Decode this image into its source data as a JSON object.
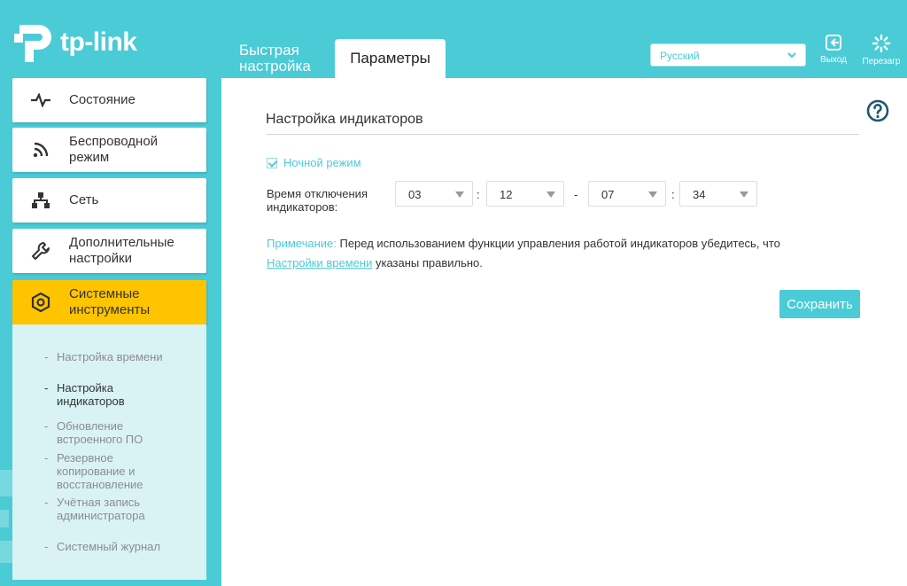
{
  "header": {
    "logo_text": "tp-link",
    "tabs": [
      {
        "label_line1": "Быстрая",
        "label_line2": "настройка"
      },
      {
        "label": "Параметры"
      }
    ],
    "language": {
      "selected": "Русский"
    },
    "logout_label": "Выход",
    "reboot_label": "Перезагр"
  },
  "sidebar": {
    "items": [
      {
        "label": "Состояние",
        "icon": "pulse-icon"
      },
      {
        "label_line1": "Беспроводной",
        "label_line2": "режим",
        "icon": "wifi-icon"
      },
      {
        "label": "Сеть",
        "icon": "network-icon"
      },
      {
        "label_line1": "Дополнительные",
        "label_line2": "настройки",
        "icon": "wrench-icon"
      },
      {
        "label_line1": "Системные",
        "label_line2": "инструменты",
        "icon": "gear-icon",
        "active": true
      }
    ],
    "submenu": [
      {
        "line1": "Настройка времени"
      },
      {
        "line1": "Настройка",
        "line2": "индикаторов",
        "current": true
      },
      {
        "line1": "Обновление",
        "line2": "встроенного ПО"
      },
      {
        "line1": "Резервное",
        "line2": "копирование и",
        "line3": "восстановление"
      },
      {
        "line1": "Учётная запись",
        "line2": "администратора"
      },
      {
        "line1": "Системный журнал"
      }
    ]
  },
  "main": {
    "title": "Настройка индикаторов",
    "night_mode": {
      "label": "Ночной режим",
      "checked": true
    },
    "off_time": {
      "label_line1": "Время отключения",
      "label_line2": "индикаторов:",
      "start_hour": "03",
      "start_minute": "12",
      "end_hour": "07",
      "end_minute": "34",
      "colon": ":",
      "dash": "-"
    },
    "note": {
      "prefix": "Примечание:",
      "text1": "Перед использованием функции управления работой индикаторов убедитесь, что",
      "link": "Настройки времени",
      "text2": "указаны правильно."
    },
    "save_label": "Сохранить"
  },
  "colors": {
    "accent": "#4acbd6",
    "active": "#ffc400"
  }
}
